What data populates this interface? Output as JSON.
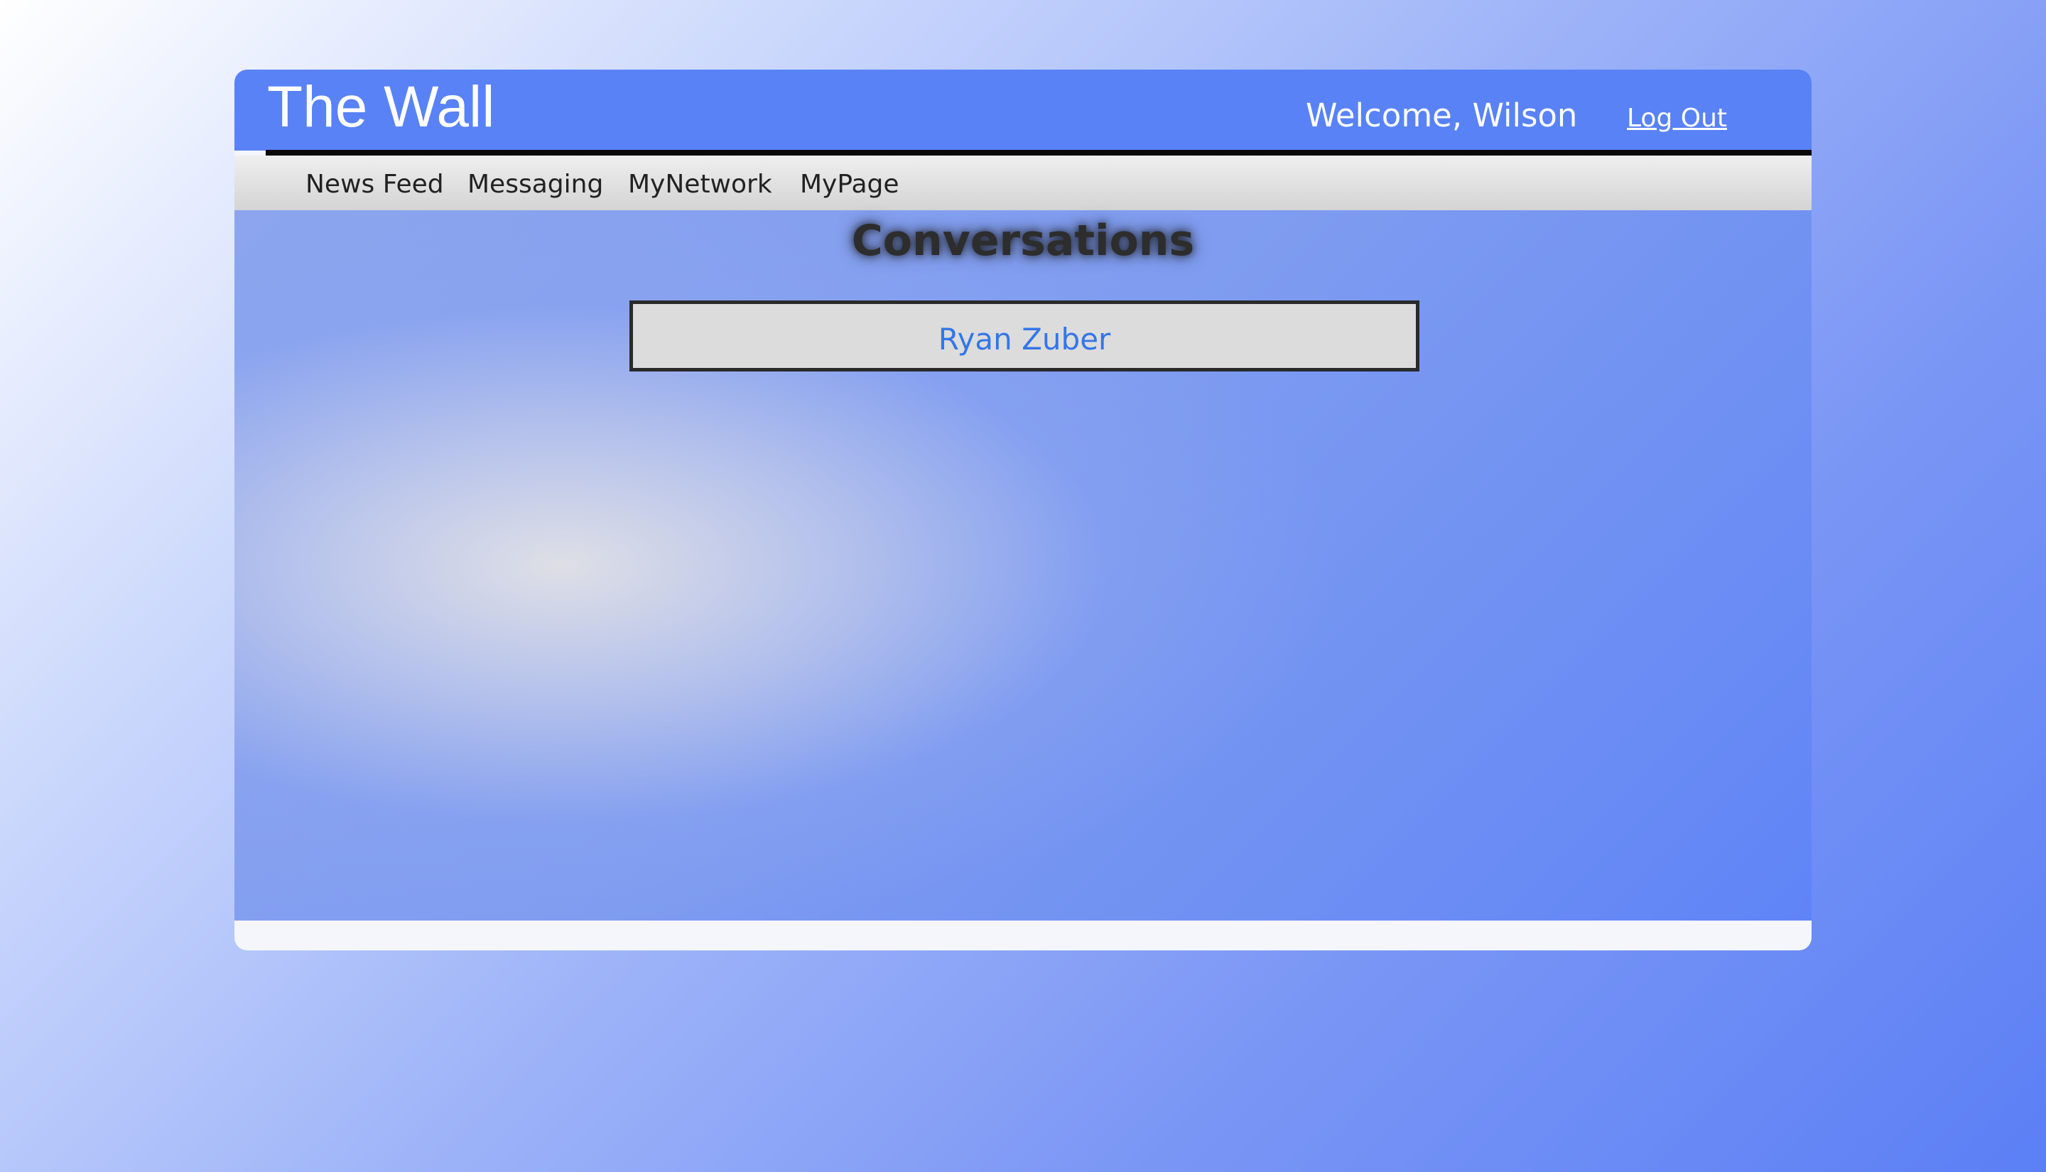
{
  "header": {
    "brand": "The Wall",
    "welcome": "Welcome, Wilson",
    "logout_label": "Log Out"
  },
  "nav": {
    "items": [
      {
        "label": "News Feed"
      },
      {
        "label": "Messaging"
      },
      {
        "label": "MyNetwork"
      },
      {
        "label": "MyPage"
      }
    ]
  },
  "main": {
    "title": "Conversations",
    "conversations": [
      {
        "name": "Ryan Zuber"
      }
    ]
  },
  "colors": {
    "header_bg": "#5882f6",
    "link_blue": "#3476e8",
    "nav_bg": "#e3e3e3"
  }
}
